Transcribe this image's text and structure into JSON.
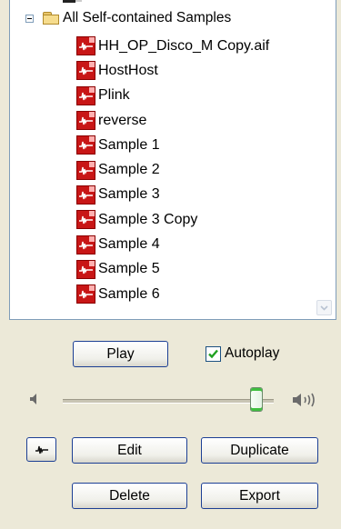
{
  "tree": {
    "root_label": "All Self-contained Samples",
    "items": [
      {
        "label": "HH_OP_Disco_M Copy.aif"
      },
      {
        "label": "HostHost"
      },
      {
        "label": "Plink"
      },
      {
        "label": "reverse"
      },
      {
        "label": "Sample 1"
      },
      {
        "label": "Sample 2"
      },
      {
        "label": "Sample 3"
      },
      {
        "label": "Sample 3 Copy"
      },
      {
        "label": "Sample 4"
      },
      {
        "label": "Sample 5"
      },
      {
        "label": "Sample 6"
      }
    ]
  },
  "controls": {
    "play_label": "Play",
    "autoplay_label": "Autoplay",
    "autoplay_checked": true,
    "volume_level": 0.92,
    "edit_label": "Edit",
    "duplicate_label": "Duplicate",
    "delete_label": "Delete",
    "export_label": "Export"
  },
  "icons": {
    "folder": "folder-icon",
    "sample": "sound-file-icon",
    "volume_low": "speaker-low-icon",
    "volume_high": "speaker-high-icon",
    "waveform": "waveform-icon"
  },
  "colors": {
    "window_bg": "#ece9d8",
    "button_border": "#1c3f94",
    "sound_icon": "#c81616",
    "checkbox_check": "#21a121"
  }
}
